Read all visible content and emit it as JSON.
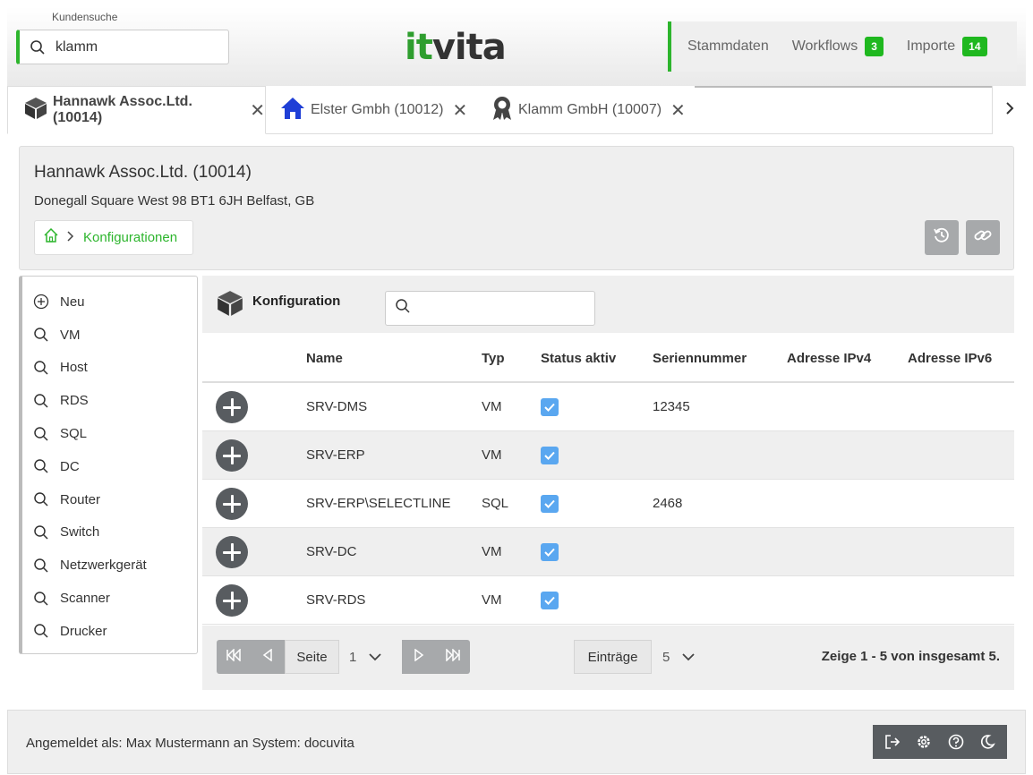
{
  "header": {
    "search_caption": "Kundensuche",
    "search_value": "klamm",
    "logo_it": "it",
    "logo_vita": "vita",
    "nav": [
      {
        "label": "Stammdaten",
        "badge": null
      },
      {
        "label": "Workflows",
        "badge": "3"
      },
      {
        "label": "Importe",
        "badge": "14"
      }
    ]
  },
  "tabs": [
    {
      "label": "Hannawk Assoc.Ltd. (10014)",
      "icon": "cube-icon",
      "active": true
    },
    {
      "label": "Elster Gmbh (10012)",
      "icon": "home-icon",
      "active": false
    },
    {
      "label": "Klamm GmbH (10007)",
      "icon": "award-icon",
      "active": false
    }
  ],
  "info": {
    "title": "Hannawk Assoc.Ltd. (10014)",
    "address": "Donegall Square West 98 BT1 6JH Belfast, GB",
    "breadcrumb_label": "Konfigurationen"
  },
  "sidemenu": [
    {
      "label": "Neu",
      "icon": "plus-circle-icon"
    },
    {
      "label": "VM",
      "icon": "search-icon"
    },
    {
      "label": "Host",
      "icon": "search-icon"
    },
    {
      "label": "RDS",
      "icon": "search-icon"
    },
    {
      "label": "SQL",
      "icon": "search-icon"
    },
    {
      "label": "DC",
      "icon": "search-icon"
    },
    {
      "label": "Router",
      "icon": "search-icon"
    },
    {
      "label": "Switch",
      "icon": "search-icon"
    },
    {
      "label": "Netzwerkgerät",
      "icon": "search-icon"
    },
    {
      "label": "Scanner",
      "icon": "search-icon"
    },
    {
      "label": "Drucker",
      "icon": "search-icon"
    }
  ],
  "main": {
    "title": "Konfiguration",
    "search_value": "",
    "columns": [
      "Name",
      "Typ",
      "Status aktiv",
      "Seriennummer",
      "Adresse IPv4",
      "Adresse IPv6"
    ],
    "rows": [
      {
        "name": "SRV-DMS",
        "typ": "VM",
        "status": true,
        "serial": "12345",
        "ipv4": "",
        "ipv6": ""
      },
      {
        "name": "SRV-ERP",
        "typ": "VM",
        "status": true,
        "serial": "",
        "ipv4": "",
        "ipv6": ""
      },
      {
        "name": "SRV-ERP\\SELECTLINE",
        "typ": "SQL",
        "status": true,
        "serial": "2468",
        "ipv4": "",
        "ipv6": ""
      },
      {
        "name": "SRV-DC",
        "typ": "VM",
        "status": true,
        "serial": "",
        "ipv4": "",
        "ipv6": ""
      },
      {
        "name": "SRV-RDS",
        "typ": "VM",
        "status": true,
        "serial": "",
        "ipv4": "",
        "ipv6": ""
      }
    ]
  },
  "pager": {
    "page_label": "Seite",
    "page_value": "1",
    "entries_label": "Einträge",
    "entries_value": "5",
    "info": "Zeige 1 - 5 von insgesamt 5."
  },
  "footer": {
    "text": "Angemeldet als: Max Mustermann an System: docuvita"
  },
  "colors": {
    "accent_green": "#2db52d",
    "badge_green": "#1fb81f",
    "checkbox_blue": "#5aa7f0",
    "button_gray": "#a7a9ab",
    "dark_gray": "#585c60"
  }
}
